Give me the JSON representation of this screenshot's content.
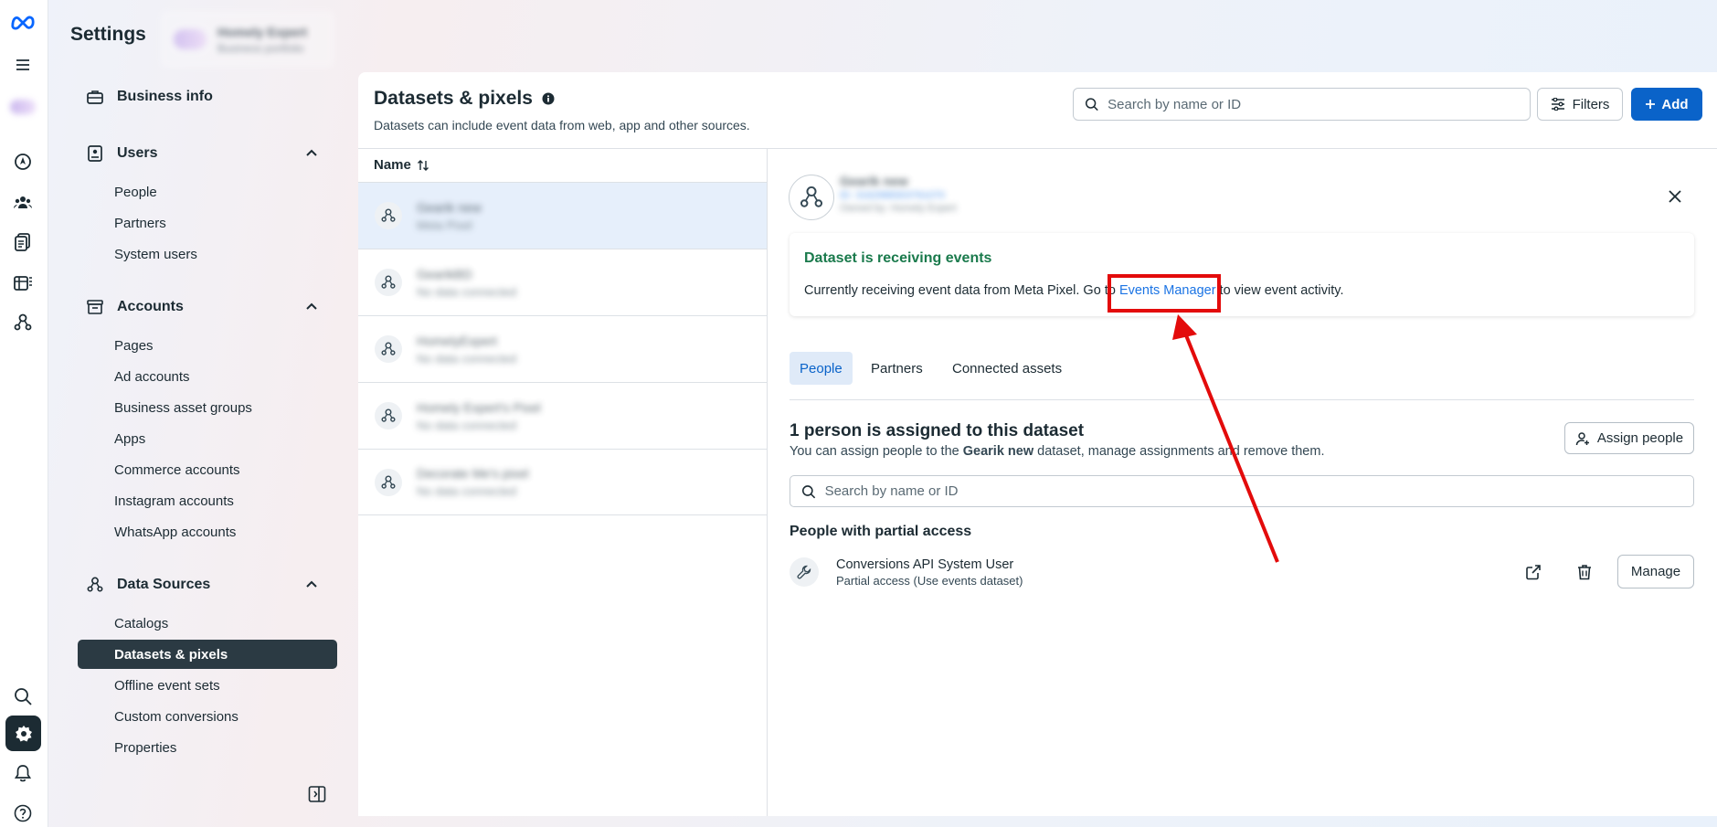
{
  "header": {
    "title": "Settings",
    "portfolio_name": "Homely Expert",
    "portfolio_type": "Business portfolio"
  },
  "sidebar": {
    "business_info": "Business info",
    "users": {
      "label": "Users",
      "items": [
        "People",
        "Partners",
        "System users"
      ]
    },
    "accounts": {
      "label": "Accounts",
      "items": [
        "Pages",
        "Ad accounts",
        "Business asset groups",
        "Apps",
        "Commerce accounts",
        "Instagram accounts",
        "WhatsApp accounts"
      ]
    },
    "data_sources": {
      "label": "Data Sources",
      "items": [
        "Catalogs",
        "Datasets & pixels",
        "Offline event sets",
        "Custom conversions",
        "Properties"
      ],
      "selected": "Datasets & pixels"
    }
  },
  "main": {
    "title": "Datasets & pixels",
    "subtitle": "Datasets can include event data from web, app and other sources.",
    "search_placeholder": "Search by name or ID",
    "filters_label": "Filters",
    "add_label": "Add",
    "list_header": "Name",
    "datasets": [
      {
        "name": "Gearik new",
        "status": "Meta Pixel"
      },
      {
        "name": "GearikBD",
        "status": "No data connected"
      },
      {
        "name": "HomelyExpert",
        "status": "No data connected"
      },
      {
        "name": "Homely Expert's Pixel",
        "status": "No data connected"
      },
      {
        "name": "Decorate Me's pixel",
        "status": "No data connected"
      }
    ]
  },
  "detail": {
    "name": "Gearik new",
    "id_line": "ID: 3162988303761070",
    "owner_line": "Owned by: Homely Expert",
    "notice_title": "Dataset is receiving events",
    "notice_pre": "Currently receiving event data from Meta Pixel. Go to ",
    "notice_link": "Events Manager",
    "notice_post": " to view event activity.",
    "tabs": [
      "People",
      "Partners",
      "Connected assets"
    ],
    "active_tab": "People",
    "assigned_title": "1 person is assigned to this dataset",
    "assigned_desc_pre": "You can assign people to the ",
    "assigned_desc_bold": "Gearik new",
    "assigned_desc_post": " dataset, manage assignments and remove them.",
    "assign_button": "Assign people",
    "search_placeholder": "Search by name or ID",
    "partial_title": "People with partial access",
    "user_name": "Conversions API System User",
    "user_access": "Partial access (Use events dataset)",
    "manage_button": "Manage"
  },
  "colors": {
    "accent": "#0a63c9",
    "success": "#1a7a4c",
    "callout": "#e30b0b",
    "selected_nav": "#2b3a43"
  },
  "icons": {
    "rail": [
      "meta-logo-icon",
      "menu-icon",
      "business-avatar-icon",
      "compass-icon",
      "people-group-icon",
      "pages-icon",
      "table-icon",
      "data-sources-icon",
      "search-icon",
      "settings-icon",
      "bell-icon",
      "help-icon"
    ]
  }
}
